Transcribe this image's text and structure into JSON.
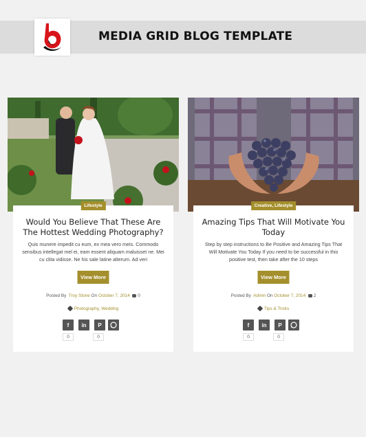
{
  "header": {
    "title": "MEDIA GRID BLOG TEMPLATE"
  },
  "posts": [
    {
      "category_chip": "Lifestyle",
      "title": "Would You Believe That These Are The Hottest Wedding Photography?",
      "excerpt": "Quis munere impedit cu eum, ex mea vero meis. Commodo sensibus intellegat mel ei, eam essent aliquam maluisset ne. Mei cu clita vidisse. Ne his sale latine alterum. Ad veri",
      "button": "View More",
      "posted_by_label": "Posted By",
      "author": "Troy Stone",
      "on_label": "On",
      "date": "October 7, 2014",
      "comments": "0",
      "categories": "Photography, Wedding",
      "share_counts": [
        "0",
        "0"
      ]
    },
    {
      "category_chip": "Creative, Lifestyle",
      "title": "Amazing Tips That Will Motivate You Today",
      "excerpt": "Step by step instructions to Be Positive and Amazing Tips That Will Motivate You Today If you need to be successful in this positive test, then take after the 10 steps",
      "button": "View More",
      "posted_by_label": "Posted By",
      "author": "Admin",
      "on_label": "On",
      "date": "October 7, 2014",
      "comments": "2",
      "categories": "Tips & Tricks",
      "share_counts": [
        "0",
        "0"
      ]
    }
  ],
  "share_icons": [
    "facebook-icon",
    "linkedin-icon",
    "pinterest-icon",
    "whatsapp-icon"
  ],
  "colors": {
    "accent": "#a48f2c",
    "header_band": "#dcdcdc",
    "background": "#f1f1f1",
    "logo_red": "#d8141b"
  }
}
